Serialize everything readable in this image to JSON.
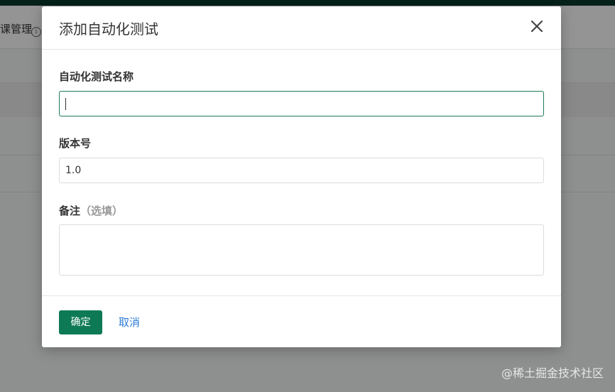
{
  "background": {
    "header_title": "课管理",
    "info_icon": "info-icon"
  },
  "modal": {
    "title": "添加自动化测试",
    "close_icon": "close-icon",
    "fields": {
      "name": {
        "label": "自动化测试名称",
        "value": ""
      },
      "version": {
        "label": "版本号",
        "value": "1.0"
      },
      "remark": {
        "label": "备注",
        "optional": "（选填）",
        "value": ""
      }
    },
    "footer": {
      "ok_label": "确定",
      "cancel_label": "取消"
    }
  },
  "watermark": "@稀土掘金技术社区",
  "colors": {
    "primary": "#0e7a55",
    "link": "#2f7bd6",
    "active_border": "#1f7a56",
    "topbar": "#0a3a2c"
  }
}
